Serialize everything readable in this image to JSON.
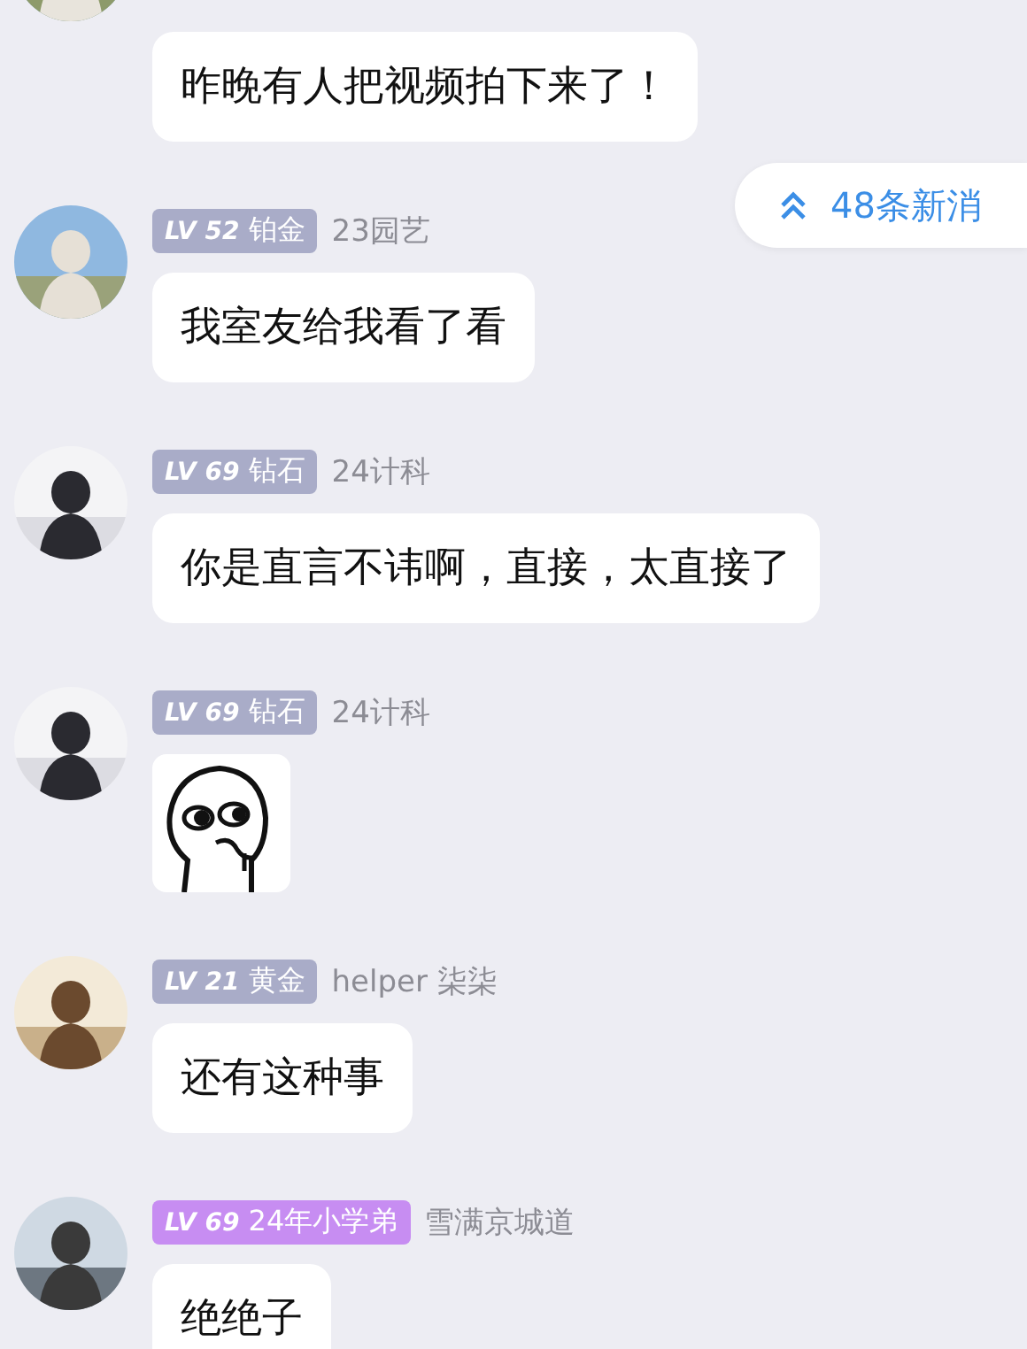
{
  "new_messages": {
    "label": "48条新消"
  },
  "messages": [
    {
      "kind": "text",
      "text": "昨晚有人把视频拍下来了！"
    },
    {
      "kind": "text",
      "badge": {
        "level": "LV 52",
        "title": "铂金",
        "color": "#a9acc8"
      },
      "name": "23园艺",
      "text": "我室友给我看了看"
    },
    {
      "kind": "text",
      "badge": {
        "level": "LV 69",
        "title": "钻石",
        "color": "#a9acc8"
      },
      "name": "24计科",
      "text": "你是直言不讳啊，直接，太直接了"
    },
    {
      "kind": "sticker",
      "badge": {
        "level": "LV 69",
        "title": "钻石",
        "color": "#a9acc8"
      },
      "name": "24计科"
    },
    {
      "kind": "text",
      "badge": {
        "level": "LV 21",
        "title": "黄金",
        "color": "#a9acc8"
      },
      "name": "helper 柒柒",
      "text": "还有这种事"
    },
    {
      "kind": "text",
      "badge": {
        "level": "LV 69",
        "title": "24年小学弟",
        "color": "#c78df2"
      },
      "name": "雪满京城道",
      "text": "绝绝子"
    }
  ]
}
